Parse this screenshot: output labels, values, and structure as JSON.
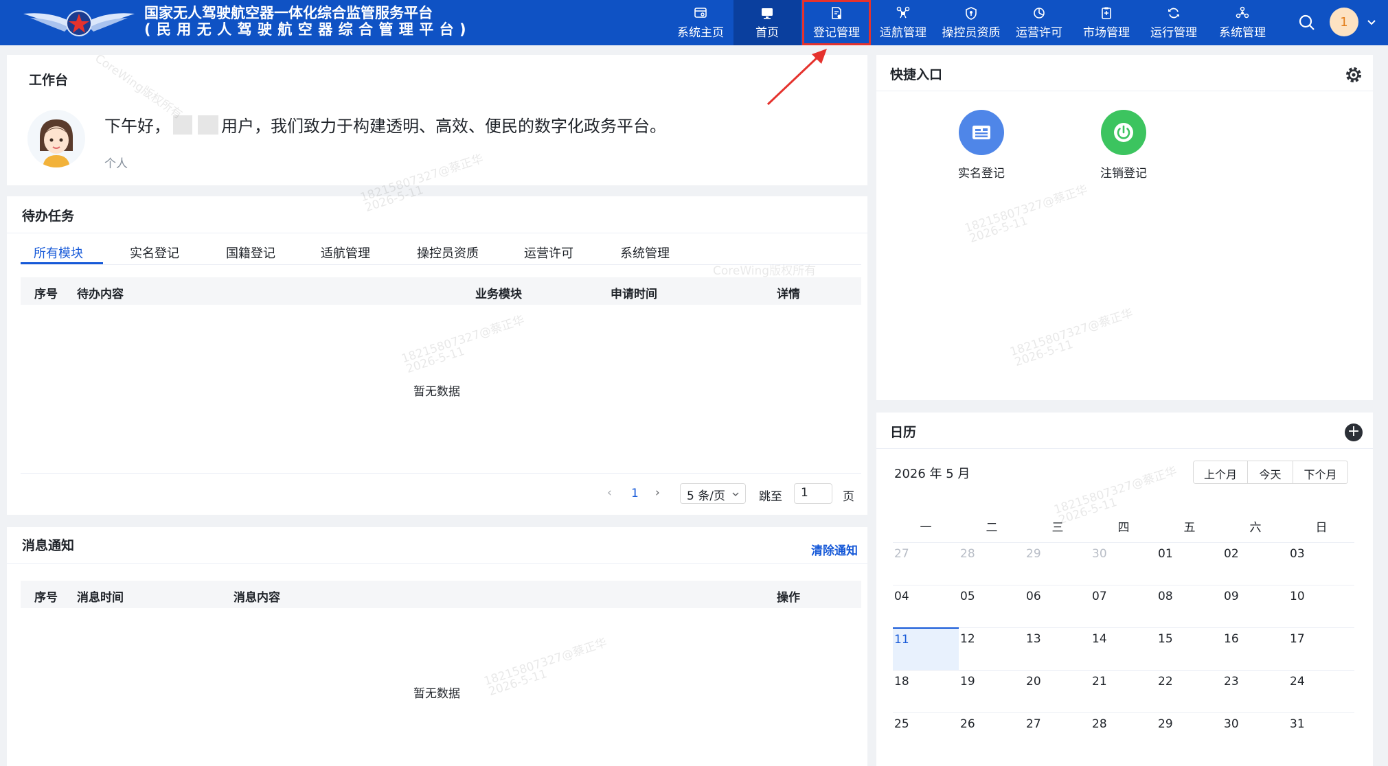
{
  "header": {
    "title_line1": "国家无人驾驶航空器一体化综合监管服务平台",
    "title_line2": "(民用无人驾驶航空器综合管理平台)",
    "nav": [
      {
        "label": "系统主页",
        "icon": "browser-icon"
      },
      {
        "label": "首页",
        "icon": "monitor-icon",
        "active": true
      },
      {
        "label": "登记管理",
        "icon": "document-icon",
        "highlighted": true
      },
      {
        "label": "适航管理",
        "icon": "drone-icon"
      },
      {
        "label": "操控员资质",
        "icon": "shield-icon"
      },
      {
        "label": "运营许可",
        "icon": "pie-chart-icon"
      },
      {
        "label": "市场管理",
        "icon": "clipboard-icon"
      },
      {
        "label": "运行管理",
        "icon": "refresh-icon"
      },
      {
        "label": "系统管理",
        "icon": "network-icon"
      }
    ],
    "avatar_text": "1",
    "colors": {
      "bar": "#0f52c4",
      "active_nav": "#0a3f9e",
      "highlight": "#e5322d"
    }
  },
  "workspace": {
    "title": "工作台",
    "greeting_prefix": "下午好，",
    "greeting_suffix": "用户，我们致力于构建透明、高效、便民的数字化政务平台。",
    "user_type": "个人"
  },
  "todo": {
    "title": "待办任务",
    "tabs": [
      "所有模块",
      "实名登记",
      "国籍登记",
      "适航管理",
      "操控员资质",
      "运营许可",
      "系统管理"
    ],
    "active_tab": 0,
    "columns": [
      "序号",
      "待办内容",
      "业务模块",
      "申请时间",
      "详情"
    ],
    "empty_text": "暂无数据",
    "pager": {
      "prev": "‹",
      "current_page": "1",
      "next": "›",
      "page_size": "5 条/页",
      "jump_label": "跳至",
      "jump_value": "1",
      "page_unit": "页"
    }
  },
  "messages": {
    "title": "消息通知",
    "clear_label": "清除通知",
    "columns": [
      "序号",
      "消息时间",
      "消息内容",
      "操作"
    ],
    "empty_text": "暂无数据"
  },
  "quick": {
    "title": "快捷入口",
    "items": [
      {
        "label": "实名登记",
        "icon": "id-card-icon",
        "color": "#4f86e8"
      },
      {
        "label": "注销登记",
        "icon": "power-icon",
        "color": "#3cc45f"
      }
    ]
  },
  "calendar": {
    "title": "日历",
    "month_label": "2026 年 5 月",
    "buttons": [
      "上个月",
      "今天",
      "下个月"
    ],
    "weekdays": [
      "一",
      "二",
      "三",
      "四",
      "五",
      "六",
      "日"
    ],
    "today": "11",
    "rows": [
      [
        {
          "d": "27",
          "o": true
        },
        {
          "d": "28",
          "o": true
        },
        {
          "d": "29",
          "o": true
        },
        {
          "d": "30",
          "o": true
        },
        {
          "d": "01"
        },
        {
          "d": "02"
        },
        {
          "d": "03"
        }
      ],
      [
        {
          "d": "04"
        },
        {
          "d": "05"
        },
        {
          "d": "06"
        },
        {
          "d": "07"
        },
        {
          "d": "08"
        },
        {
          "d": "09"
        },
        {
          "d": "10"
        }
      ],
      [
        {
          "d": "11"
        },
        {
          "d": "12"
        },
        {
          "d": "13"
        },
        {
          "d": "14"
        },
        {
          "d": "15"
        },
        {
          "d": "16"
        },
        {
          "d": "17"
        }
      ],
      [
        {
          "d": "18"
        },
        {
          "d": "19"
        },
        {
          "d": "20"
        },
        {
          "d": "21"
        },
        {
          "d": "22"
        },
        {
          "d": "23"
        },
        {
          "d": "24"
        }
      ],
      [
        {
          "d": "25"
        },
        {
          "d": "26"
        },
        {
          "d": "27"
        },
        {
          "d": "28"
        },
        {
          "d": "29"
        },
        {
          "d": "30"
        },
        {
          "d": "31"
        }
      ]
    ]
  },
  "watermarks": {
    "copyright": "CoreWing版权所有",
    "user_mark": "18215807327@蔡正华",
    "date_mark": "2026-5-11"
  }
}
